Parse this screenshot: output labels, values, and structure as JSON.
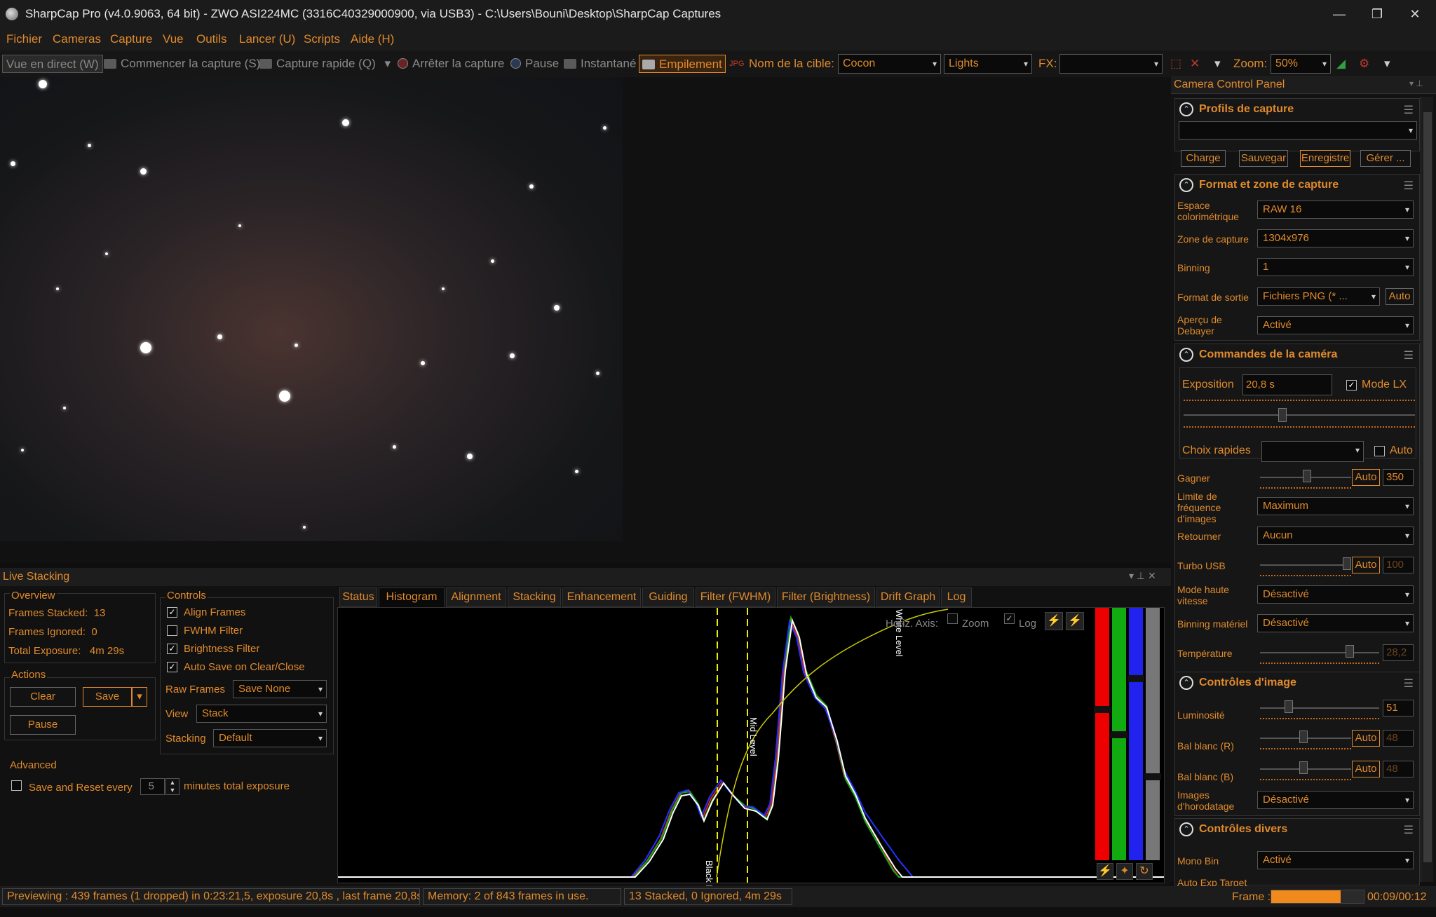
{
  "title": "SharpCap Pro (v4.0.9063, 64 bit) - ZWO ASI224MC (3316C40329000900, via USB3) - C:\\Users\\Bouni\\Desktop\\SharpCap Captures",
  "menu": [
    "Fichier",
    "Cameras",
    "Capture",
    "Vue",
    "Outils",
    "Lancer (U)",
    "Scripts",
    "Aide (H)"
  ],
  "toolbar": {
    "live": "Vue en direct (W)",
    "start_capture": "Commencer la capture (S)",
    "quick_capture": "Capture rapide (Q)",
    "stop_capture": "Arrêter la capture",
    "pause": "Pause",
    "snapshot": "Instantané",
    "stacking": "Empilement",
    "target_label": "Nom de la cible:",
    "target_value": "Cocon",
    "frame_type": "Lights",
    "fx_label": "FX:",
    "fx_value": "",
    "zoom_label": "Zoom:",
    "zoom_value": "50%"
  },
  "panel": {
    "title": "Camera Control Panel",
    "profiles": {
      "title": "Profils de capture",
      "value": "",
      "buttons": [
        "Charge",
        "Sauvegar",
        "Enregistre",
        "Gérer ..."
      ]
    },
    "format": {
      "title": "Format et zone de capture",
      "rows": [
        {
          "label": "Espace colorimétrique",
          "value": "RAW 16"
        },
        {
          "label": "Zone de capture",
          "value": "1304x976"
        },
        {
          "label": "Binning",
          "value": "1"
        },
        {
          "label": "Format de sortie",
          "value": "Fichiers PNG (* ...",
          "extra": "Auto"
        },
        {
          "label": "Aperçu de Debayer",
          "value": "Activé"
        }
      ]
    },
    "camera": {
      "title": "Commandes de la caméra",
      "exposure_label": "Exposition",
      "exposure_value": "20,8 s",
      "lx_label": "Mode LX",
      "lx_checked": true,
      "quick_label": "Choix rapides",
      "quick_value": "",
      "auto_label": "Auto",
      "gain_label": "Gagner",
      "gain_auto": "Auto",
      "gain_value": "350",
      "fps_label": "Limite de fréquence d'images",
      "fps_value": "Maximum",
      "flip_label": "Retourner",
      "flip_value": "Aucun",
      "usb_label": "Turbo USB",
      "usb_auto": "Auto",
      "usb_value": "100",
      "hs_label": "Mode haute vitesse",
      "hs_value": "Désactivé",
      "hwbin_label": "Binning matériel",
      "hwbin_value": "Désactivé",
      "temp_label": "Température",
      "temp_value": "28,2"
    },
    "image": {
      "title": "Contrôles d'image",
      "brightness_label": "Luminosité",
      "brightness_value": "51",
      "wbr_label": "Bal blanc (R)",
      "wbr_auto": "Auto",
      "wbr_value": "48",
      "wbb_label": "Bal blanc (B)",
      "wbb_auto": "Auto",
      "wbb_value": "48",
      "ts_label": "Images d'horodatage",
      "ts_value": "Désactivé"
    },
    "misc": {
      "title": "Contrôles divers",
      "monobin_label": "Mono Bin",
      "monobin_value": "Activé",
      "autoexp_label": "Auto Exp Target"
    }
  },
  "livestack": {
    "title": "Live Stacking",
    "overview_title": "Overview",
    "frames_stacked": "Frames Stacked:  13",
    "frames_ignored": "Frames Ignored:  0",
    "total_exposure": "Total Exposure:   4m 29s",
    "actions_title": "Actions",
    "clear": "Clear",
    "save": "Save",
    "pause": "Pause",
    "advanced_title": "Advanced",
    "save_reset": "Save and Reset every",
    "save_reset_value": "5",
    "save_reset_suffix": "minutes total exposure",
    "controls_title": "Controls",
    "align": "Align Frames",
    "fwhm": "FWHM Filter",
    "brightness": "Brightness Filter",
    "autosave": "Auto Save on Clear/Close",
    "raw_label": "Raw Frames",
    "raw_value": "Save None",
    "view_label": "View",
    "view_value": "Stack",
    "stacking_label": "Stacking",
    "stacking_value": "Default",
    "tabs": [
      "Status",
      "Histogram",
      "Alignment",
      "Stacking",
      "Enhancement",
      "Guiding",
      "Filter (FWHM)",
      "Filter (Brightness)",
      "Drift Graph",
      "Log"
    ],
    "selected_tab": "Histogram",
    "hist": {
      "horiz_axis": "Horiz. Axis:",
      "zoom": "Zoom",
      "log": "Log",
      "black_level": "Black Level",
      "mid_level": "Mid Level",
      "white_level": "White Level"
    }
  },
  "status": {
    "preview": "Previewing : 439 frames (1 dropped) in 0:23:21,5, exposure 20,8s , last frame 20,8s",
    "memory": "Memory: 2 of 843 frames in use.",
    "stack": "13 Stacked, 0 Ignored, 4m 29s",
    "frame_label": "Frame :",
    "frame_time": "00:09/00:12",
    "frame_progress": 0.75
  },
  "colors": {
    "accent": "#e08a2c",
    "bg": "#111111"
  }
}
